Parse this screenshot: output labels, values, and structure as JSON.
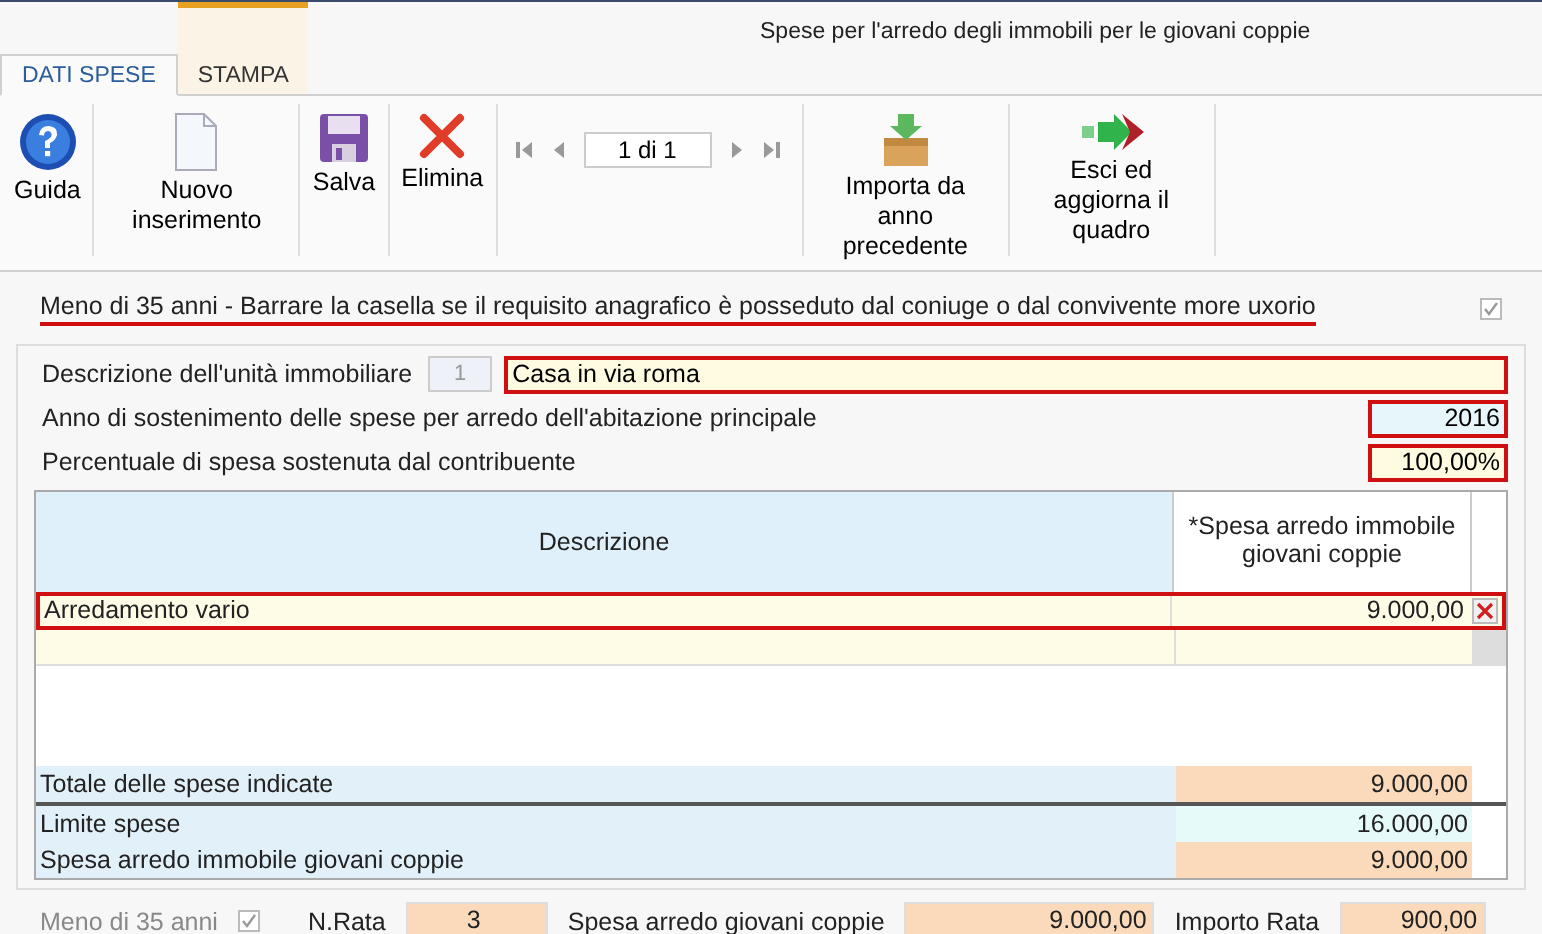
{
  "window": {
    "title": "Spese per l'arredo degli immobili per le giovani coppie"
  },
  "tabs": [
    {
      "label": "DATI SPESE",
      "selected": true
    },
    {
      "label": "STAMPA",
      "selected": false
    }
  ],
  "toolbar": [
    {
      "kind": "help",
      "label": "Guida"
    },
    {
      "kind": "new",
      "label": "Nuovo inserimento"
    },
    {
      "kind": "save",
      "label": "Salva"
    },
    {
      "kind": "delete",
      "label": "Elimina"
    },
    {
      "kind": "pager",
      "value": "1 di 1"
    },
    {
      "kind": "import",
      "label": "Importa da anno precedente"
    },
    {
      "kind": "exit",
      "label": "Esci ed aggiorna il quadro"
    }
  ],
  "under35": {
    "label": "Meno di 35 anni - Barrare la casella se il requisito anagrafico è posseduto dal coniuge o dal convivente more uxorio",
    "checked": true,
    "highlighted": true
  },
  "fields": [
    {
      "kind": "description",
      "label": "Descrizione dell'unità immobiliare",
      "index": "1",
      "value": "Casa in via roma",
      "highlighted": true
    },
    {
      "kind": "year",
      "label": "Anno di sostenimento delle spese per arredo dell'abitazione principale",
      "value": "2016",
      "highlighted": true
    },
    {
      "kind": "percent",
      "label": "Percentuale di spesa sostenuta dal contribuente",
      "value": "100,00%",
      "highlighted": true
    }
  ],
  "table": {
    "columns": [
      "Descrizione",
      "*Spesa arredo immobile giovani coppie"
    ],
    "rows": [
      {
        "description": "Arredamento vario",
        "amount": "9.000,00",
        "highlighted": true
      }
    ],
    "totals": [
      {
        "kind": "computed",
        "label": "Totale delle spese indicate",
        "value": "9.000,00"
      },
      {
        "kind": "limit",
        "label": "Limite spese",
        "value": "16.000,00"
      },
      {
        "kind": "computed",
        "label": "Spesa arredo immobile giovani coppie",
        "value": "9.000,00"
      }
    ]
  },
  "footer": {
    "under35_label": "Meno di 35 anni",
    "under35_checked": true,
    "rata_label": "N.Rata",
    "rata": "3",
    "spesa_label": "Spesa arredo giovani coppie",
    "spesa": "9.000,00",
    "importo_label": "Importo Rata",
    "importo": "900,00"
  }
}
